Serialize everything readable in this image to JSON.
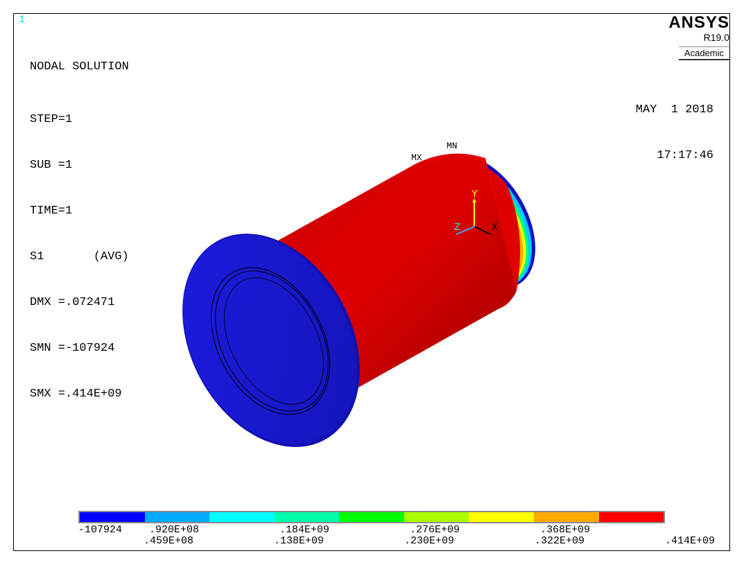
{
  "window": {
    "number": "1"
  },
  "legend": {
    "title": "NODAL SOLUTION",
    "step": "STEP=1",
    "sub": "SUB =1",
    "time": "TIME=1",
    "item": "S1       (AVG)",
    "dmx": "DMX =.072471",
    "smn": "SMN =-107924",
    "smx": "SMX =.414E+09"
  },
  "logo": {
    "brand": "ANSYS",
    "release": "R19.0",
    "license": "Academic"
  },
  "date": {
    "day": "MAY  1 2018",
    "time": "17:17:46"
  },
  "model": {
    "min_label": "MN",
    "max_label": "MX",
    "triad": {
      "x": "X",
      "y": "Y",
      "z": "Z"
    },
    "colors": {
      "shell": "#dd0000",
      "flange": "#1a1adc"
    }
  },
  "colorbar": {
    "colors": [
      "#0000ff",
      "#00aaff",
      "#00ffff",
      "#00ffaa",
      "#00ff00",
      "#aaff00",
      "#ffff00",
      "#ffaa00",
      "#ff0000"
    ],
    "labels_top": [
      "-107924",
      ".920E+08",
      ".184E+09",
      ".276E+09",
      ".368E+09"
    ],
    "labels_bottom": [
      ".459E+08",
      ".138E+09",
      ".230E+09",
      ".322E+09",
      ".414E+09"
    ]
  }
}
